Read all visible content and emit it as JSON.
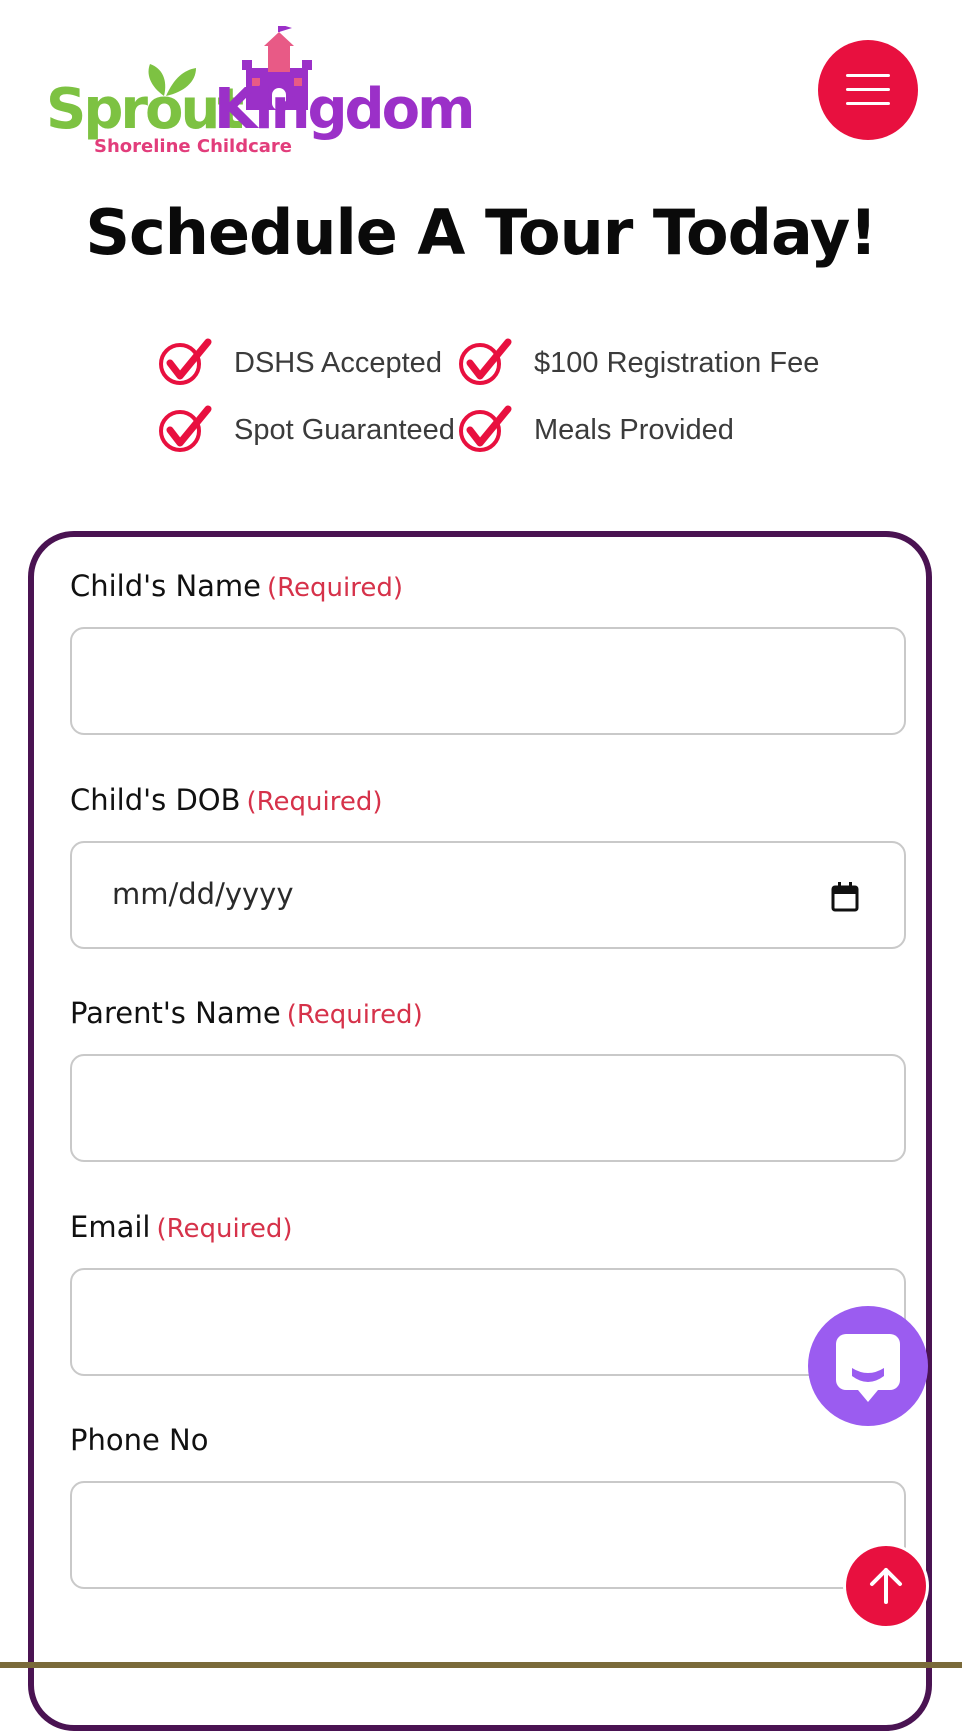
{
  "header": {
    "logo": {
      "word_1": "Sprout",
      "word_2": "Kingdom",
      "tagline": "Shoreline Childcare"
    },
    "menu_icon": "hamburger-icon"
  },
  "hero": {
    "title": "Schedule A Tour Today!",
    "features": [
      {
        "label": "DSHS Accepted",
        "icon": "checkmark-icon"
      },
      {
        "label": "$100 Registration Fee",
        "icon": "checkmark-icon"
      },
      {
        "label": "Spot Guaranteed",
        "icon": "checkmark-icon"
      },
      {
        "label": "Meals Provided",
        "icon": "checkmark-icon"
      }
    ]
  },
  "form": {
    "required_tag": "(Required)",
    "fields": [
      {
        "label": "Child's Name",
        "required": true,
        "value": ""
      },
      {
        "label": "Child's DOB",
        "required": true,
        "value": "",
        "placeholder": "mm/dd/yyyy",
        "icon": "calendar-icon"
      },
      {
        "label": "Parent's Name",
        "required": true,
        "value": ""
      },
      {
        "label": "Email",
        "required": true,
        "value": ""
      },
      {
        "label": "Phone No",
        "required": false,
        "value": ""
      }
    ]
  },
  "floating": {
    "chat_icon": "chat-bubble-icon",
    "back_to_top_icon": "arrow-up-icon"
  },
  "colors": {
    "brand_red": "#e8103f",
    "brand_purple": "#9b30c8",
    "brand_green": "#7dc242",
    "form_border": "#4a1352",
    "required_text": "#d6324a",
    "chat_purple": "#9b5cf0"
  }
}
